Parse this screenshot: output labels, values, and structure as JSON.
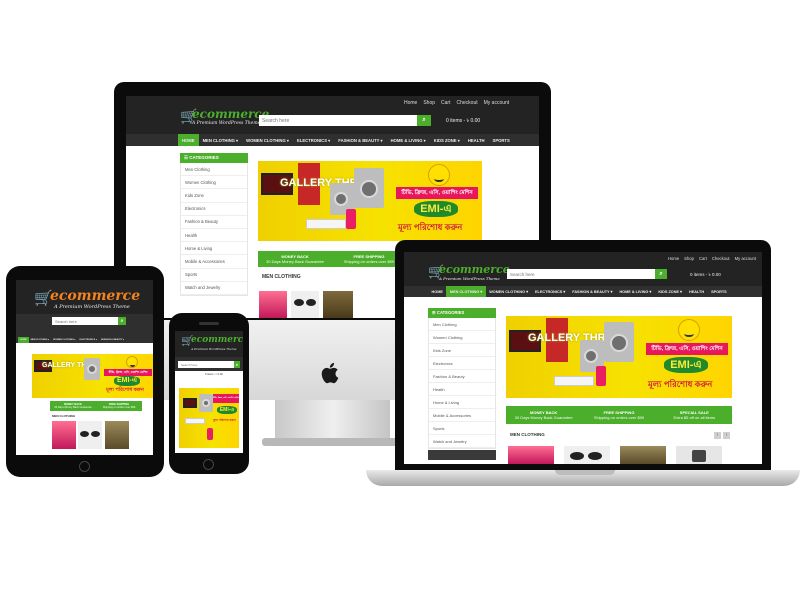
{
  "site": {
    "logo_word": "ecommerce",
    "logo_tagline": "A Premium WordPress Theme",
    "top_links": [
      "Home",
      "Shop",
      "Cart",
      "Checkout",
      "My account"
    ],
    "search_placeholder": "Search here",
    "search_button_icon": "search-icon",
    "cart_text": "0 items - ৳ 0.00",
    "nav": [
      "HOME",
      "MEN CLOTHING ▾",
      "WOMEN CLOTHING ▾",
      "ELECTRONICS ▾",
      "FASHION & BEAUTY ▾",
      "HOME & LIVING ▾",
      "KIDS ZONE ▾",
      "HEALTH",
      "SPORTS"
    ],
    "categories_title": "CATEGORIES",
    "categories": [
      "Men Clothing",
      "Women Clothing",
      "Kids Zone",
      "Electronics",
      "Fashion & Beauty",
      "Health",
      "Home & Living",
      "Mobile & Accessories",
      "Sports",
      "Watch and Jewelry"
    ],
    "banner": {
      "gallery_title": "GALLERY THREE",
      "offer_line": "টিভি, ফ্রিজ, এসি, ওয়াশিং মেশিন",
      "emi_text": "EMI-এ",
      "price_line": "মূল্য পরিশোধ করুন"
    },
    "promo": [
      {
        "title": "MONEY BACK",
        "sub": "30 Days Money Back Guarantee"
      },
      {
        "title": "FREE SHIPPING",
        "sub": "Shipping on orders over $99"
      },
      {
        "title": "SPECIAL SALE",
        "sub": "Extra $5 off on all items"
      }
    ],
    "section_title": "MEN CLOTHING",
    "apple_logo": "apple-icon"
  },
  "colors": {
    "accent": "#4caf2c",
    "header": "#232323",
    "nav": "#2f2f2f",
    "banner": "#f6e200",
    "pink": "#e8175d"
  }
}
